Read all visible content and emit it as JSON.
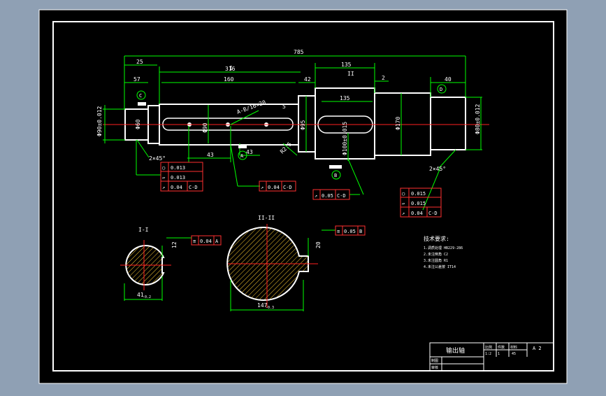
{
  "drawing": {
    "overall_length": "785",
    "dims_top": {
      "d25": "25",
      "d57": "57",
      "d316": "316",
      "d160": "160",
      "d42": "42",
      "d135a": "135",
      "d2": "2",
      "d40": "40",
      "d135b": "135"
    },
    "section_marks": {
      "I": "I",
      "II": "II"
    },
    "datum_C": "C",
    "datum_D": "D",
    "datum_A": "A",
    "datum_B": "B",
    "keyway_label": "A-B/16×20",
    "small_dim_5": "5",
    "dim_43a": "43",
    "dim_43b": "43",
    "dim_R2": "R2.5",
    "chamfer_left": "2×45°",
    "chamfer_right": "2×45°",
    "dia_left": "Φ90±0.012",
    "dia_left2": "Φ60",
    "dia_mid1": "Φ90",
    "dia_mid2": "Φ95",
    "dia_key": "Φ100±0.015",
    "dia_main": "Φ170",
    "dia_right": "Φ80±0.012",
    "tol_left": [
      {
        "sym": "◯",
        "val": "0.013"
      },
      {
        "sym": "▱",
        "val": "0.013"
      },
      {
        "sym": "↗",
        "val": "0.04",
        "ref": "C-D"
      }
    ],
    "tol_mid": {
      "sym": "↗",
      "val": "0.04",
      "ref": "C-D"
    },
    "tol_key": {
      "sym": "↗",
      "val": "0.05",
      "ref": "C-D"
    },
    "tol_right": [
      {
        "sym": "◯",
        "val": "0.015"
      },
      {
        "sym": "▱",
        "val": "0.015"
      },
      {
        "sym": "↗",
        "val": "0.04",
        "ref": "C-D"
      }
    ],
    "section1": {
      "title": "I-I",
      "dim_bottom": "41",
      "dim_bottom_tol": "-0.2",
      "dim_key": "12",
      "sym_tol": "0.04",
      "sym_ref": "A"
    },
    "section2": {
      "title": "II-II",
      "dim_bottom": "147",
      "dim_bottom_tol": "-0.3",
      "dim_key": "20",
      "sym_tol": "0.05",
      "sym_ref": "B"
    },
    "notes": {
      "title": "技术要求:",
      "lines": [
        "1.调质处理 HB229-286",
        "2.未注倒角 C2",
        "3.未注圆角 R1",
        "4.未注公差按 IT14"
      ]
    },
    "title_block": {
      "part_name": "输出轴",
      "h_scale": "比例",
      "h_qty": "件数",
      "h_material": "材料",
      "scale": "1:2",
      "qty": "1",
      "material": "45",
      "drawing_no": "A 2",
      "row1": "制图",
      "row2": "审核"
    }
  }
}
